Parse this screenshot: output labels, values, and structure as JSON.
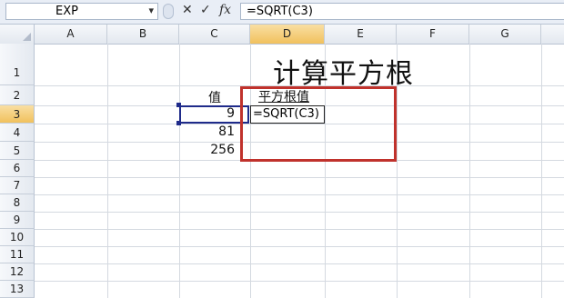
{
  "formula_bar": {
    "name_box": "EXP",
    "name_box_arrow": "▾",
    "cancel_icon": "✕",
    "enter_icon": "✓",
    "fx_label": "fx",
    "formula": "=SQRT(C3)"
  },
  "columns": [
    "A",
    "B",
    "C",
    "D",
    "E",
    "F",
    "G"
  ],
  "rows": [
    "1",
    "2",
    "3",
    "4",
    "5",
    "6",
    "7",
    "8",
    "9",
    "10",
    "11",
    "12",
    "13"
  ],
  "cells": {
    "D1": "计算平方根",
    "C2": "值",
    "D2": "平方根值",
    "C3": "9",
    "D3": "=SQRT(C3)",
    "C4": "81",
    "C5": "256"
  },
  "colors": {
    "reference_border": "#1f2b8a",
    "annotation": "#c0322c",
    "selected_header": "#f1c15d"
  }
}
